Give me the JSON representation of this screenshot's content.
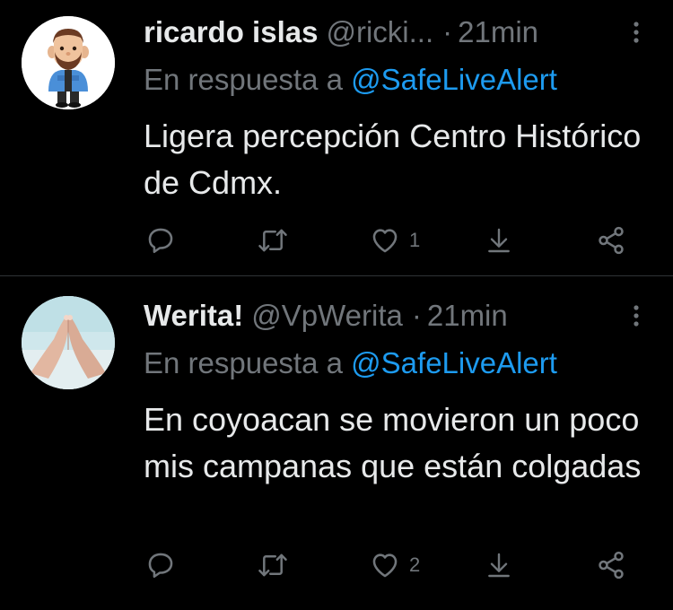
{
  "tweets": [
    {
      "name": "ricardo islas",
      "handle": "@ricki...",
      "separator": "·",
      "time": "21min",
      "reply_prefix": "En respuesta a",
      "reply_mention": "@SafeLiveAlert",
      "text": "Ligera percepción Centro Histórico de Cdmx.",
      "likes": "1",
      "avatar_icon": "cartoon-man-avatar"
    },
    {
      "name": "Werita!",
      "handle": "@VpWerita",
      "separator": "·",
      "time": "21min",
      "reply_prefix": "En respuesta a",
      "reply_mention": "@SafeLiveAlert",
      "text": "En coyoacan se movieron un poco mis campanas que están colgadas",
      "likes": "2",
      "avatar_icon": "feet-photo-avatar"
    }
  ],
  "icons": {
    "reply": "reply-icon",
    "retweet": "retweet-icon",
    "like": "heart-icon",
    "download": "download-icon",
    "share": "share-icon",
    "more": "more-vertical-icon"
  },
  "colors": {
    "background": "#000000",
    "text": "#e7e9ea",
    "muted": "#71767b",
    "link": "#1d9bf0",
    "divider": "#2f3336"
  }
}
